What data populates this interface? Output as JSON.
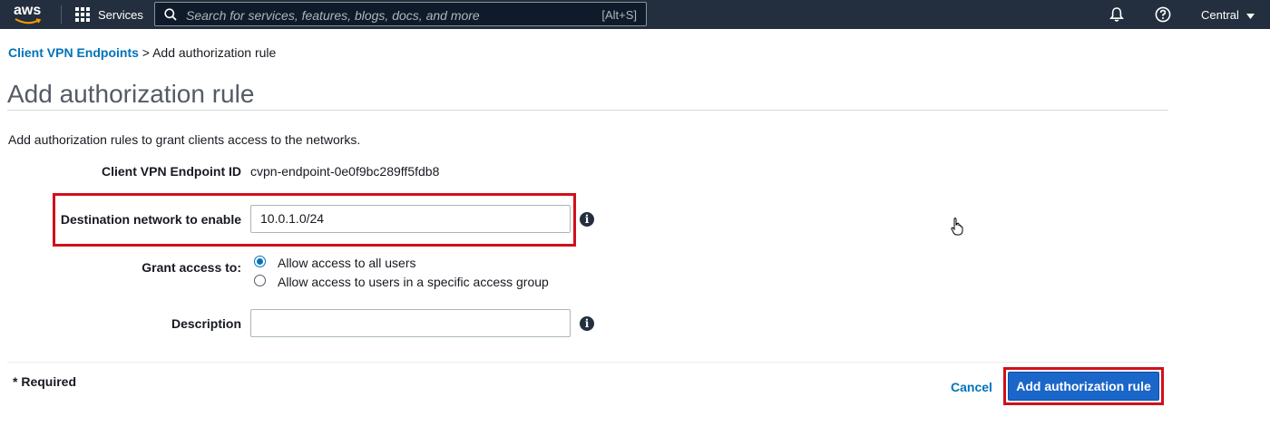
{
  "topnav": {
    "logo_text": "aws",
    "services_label": "Services",
    "search_placeholder": "Search for services, features, blogs, docs, and more",
    "search_shortcut": "[Alt+S]",
    "region_label": "Central"
  },
  "breadcrumb": {
    "parent": "Client VPN Endpoints",
    "separator": ">",
    "current": "Add authorization rule"
  },
  "page": {
    "title": "Add authorization rule",
    "intro": "Add authorization rules to grant clients access to the networks."
  },
  "form": {
    "endpoint_id_label": "Client VPN Endpoint ID",
    "endpoint_id_value": "cvpn-endpoint-0e0f9bc289ff5fdb8",
    "destination_label": "Destination network to enable",
    "destination_value": "10.0.1.0/24",
    "grant_label": "Grant access to:",
    "grant_options": [
      {
        "label": "Allow access to all users",
        "selected": true
      },
      {
        "label": "Allow access to users in a specific access group",
        "selected": false
      }
    ],
    "description_label": "Description",
    "description_value": ""
  },
  "footer": {
    "required_note": "* Required",
    "cancel_label": "Cancel",
    "submit_label": "Add authorization rule"
  },
  "colors": {
    "nav_bg": "#232f3e",
    "link": "#0073bb",
    "primary_button": "#1b66c9",
    "highlight_border": "#d0101b"
  },
  "icons": {
    "services": "grid-icon",
    "search": "search-icon",
    "notifications": "bell-icon",
    "help": "help-icon",
    "region_dropdown": "caret-down-icon",
    "info": "info-icon",
    "cursor": "hand-pointer-icon"
  }
}
